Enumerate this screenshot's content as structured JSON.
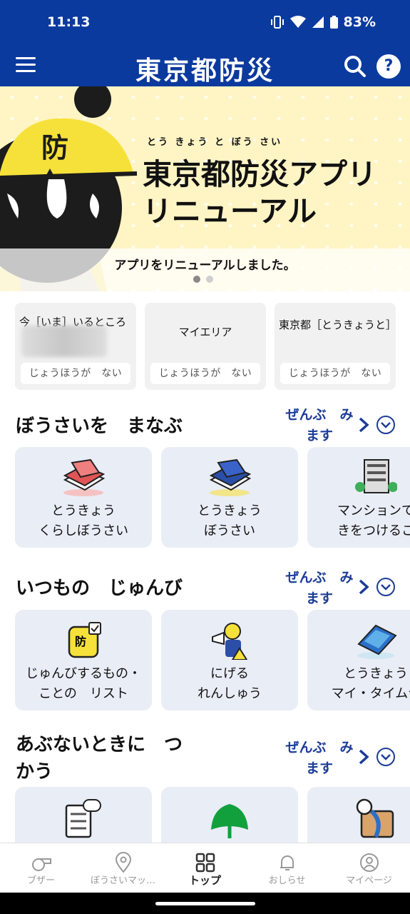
{
  "status": {
    "time": "11:13",
    "battery": "83%"
  },
  "header": {
    "title": "東京都防災",
    "help": "?"
  },
  "banner": {
    "mascot_mark": "防",
    "ruby": "とう きょう と ぼう さい",
    "title_line1": "東京都防災アプリ",
    "title_line2": "リニューアル",
    "caption": "アプリをリニューアルしました。"
  },
  "areas": [
    {
      "name": "今［いま］いるところ",
      "info": "じょうほうが　ない"
    },
    {
      "name": "マイエリア",
      "info": "じょうほうが　ない"
    },
    {
      "name": "東京都［とうきょうと］",
      "info": "じょうほうが　ない"
    }
  ],
  "sections": [
    {
      "title": "ぼうさいを　まなぶ",
      "see_all_1": "ぜんぶ　み",
      "see_all_2": "ます",
      "cards": [
        {
          "l1": "とうきょう",
          "l2": "くらしぼうさい",
          "icon": "red-book-icon"
        },
        {
          "l1": "とうきょう",
          "l2": "ぼうさい",
          "icon": "blue-book-icon"
        },
        {
          "l1": "マンションで",
          "l2": "きをつけるこ",
          "icon": "building-icon"
        }
      ]
    },
    {
      "title": "いつもの　じゅんび",
      "see_all_1": "ぜんぶ　み",
      "see_all_2": "ます",
      "cards": [
        {
          "l1": "じゅんびするもの・",
          "l2": "ことの　リスト",
          "icon": "bag-checklist-icon"
        },
        {
          "l1": "にげる",
          "l2": "れんしゅう",
          "icon": "evacuation-drill-icon"
        },
        {
          "l1": "とうきょう",
          "l2": "マイ・タイムラ",
          "icon": "timeline-book-icon"
        }
      ]
    },
    {
      "title_1": "あぶないときに　つ",
      "title_2": "かう",
      "see_all_1": "ぜんぶ　み",
      "see_all_2": "ます",
      "cards": [
        {
          "icon": "checklist-chat-icon"
        },
        {
          "icon": "tokyo-ginkgo-icon"
        },
        {
          "icon": "map-pin-icon"
        }
      ]
    }
  ],
  "bottom_nav": [
    {
      "label": "ブザー",
      "icon": "whistle-icon"
    },
    {
      "label": "ぼうさいマッ…",
      "icon": "map-pin-icon"
    },
    {
      "label": "トップ",
      "icon": "grid-icon"
    },
    {
      "label": "おしらせ",
      "icon": "bell-icon"
    },
    {
      "label": "マイページ",
      "icon": "user-icon"
    }
  ],
  "colors": {
    "header": "#0b3a9e",
    "accent": "#1d3c97",
    "banner": "#fff4c4",
    "card": "#e9edf6"
  }
}
